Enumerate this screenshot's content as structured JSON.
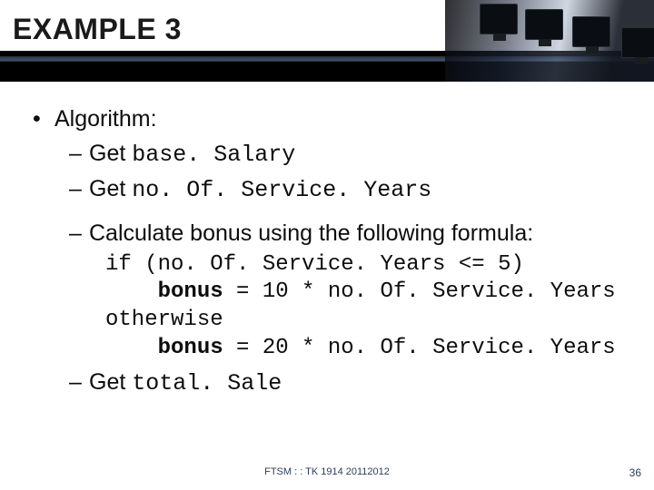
{
  "title": "EXAMPLE 3",
  "bullet1": {
    "label": "Algorithm:"
  },
  "sub": {
    "get1": {
      "prefix": "Get ",
      "code": "base. Salary"
    },
    "get2": {
      "prefix": "Get ",
      "code": "no. Of. Service. Years"
    },
    "calc": "Calculate bonus using the following formula:",
    "code": {
      "l1": "if (no. Of. Service. Years <= 5)",
      "l2a": "bonus",
      "l2b": " = 10 * no. Of. Service. Years",
      "l3": "otherwise",
      "l4a": "bonus",
      "l4b": " = 20 * no. Of. Service. Years"
    },
    "get3": {
      "prefix": "Get ",
      "code": "total. Sale"
    }
  },
  "footer": {
    "center": "FTSM : : TK 1914 20112012",
    "page": "36"
  }
}
